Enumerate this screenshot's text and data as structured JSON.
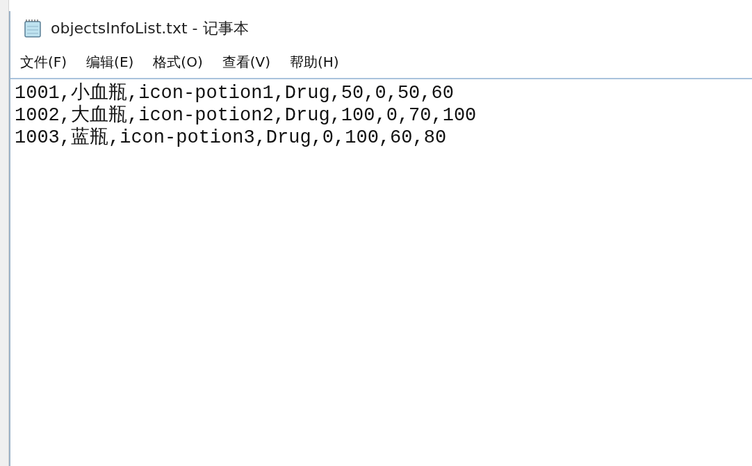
{
  "window": {
    "title": "objectsInfoList.txt - 记事本"
  },
  "menu": [
    {
      "label": "文件(F)"
    },
    {
      "label": "编辑(E)"
    },
    {
      "label": "格式(O)"
    },
    {
      "label": "查看(V)"
    },
    {
      "label": "帮助(H)"
    }
  ],
  "lines": [
    "1001,小血瓶,icon-potion1,Drug,50,0,50,60",
    "1002,大血瓶,icon-potion2,Drug,100,0,70,100",
    "1003,蓝瓶,icon-potion3,Drug,0,100,60,80"
  ]
}
